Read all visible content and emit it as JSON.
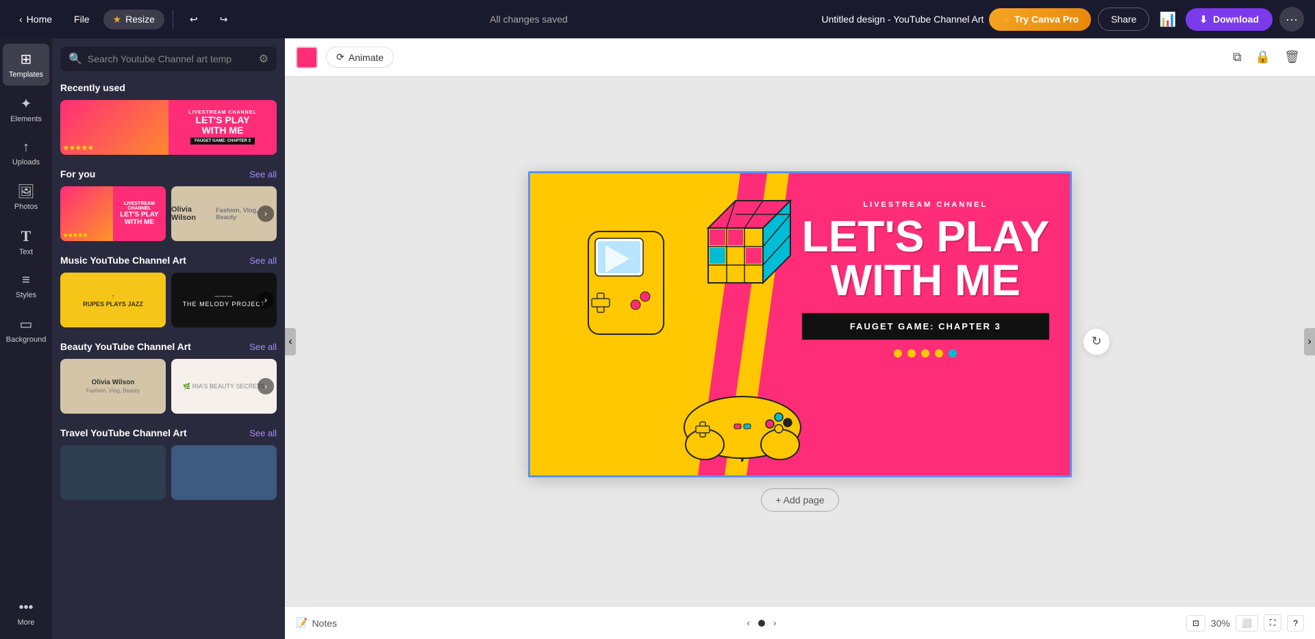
{
  "nav": {
    "home_label": "Home",
    "file_label": "File",
    "resize_label": "Resize",
    "status_label": "All changes saved",
    "title": "Untitled design - YouTube Channel Art",
    "try_pro_label": "Try Canva Pro",
    "share_label": "Share",
    "download_label": "Download"
  },
  "sidebar": {
    "items": [
      {
        "id": "templates",
        "label": "Templates",
        "icon": "⊞"
      },
      {
        "id": "elements",
        "label": "Elements",
        "icon": "✦"
      },
      {
        "id": "uploads",
        "label": "Uploads",
        "icon": "↑"
      },
      {
        "id": "photos",
        "label": "Photos",
        "icon": "🖼"
      },
      {
        "id": "text",
        "label": "Text",
        "icon": "T"
      },
      {
        "id": "styles",
        "label": "Styles",
        "icon": "≡"
      },
      {
        "id": "background",
        "label": "Background",
        "icon": "▭"
      },
      {
        "id": "more",
        "label": "More",
        "icon": "•••"
      }
    ]
  },
  "templates_panel": {
    "search_placeholder": "Search Youtube Channel art temp",
    "sections": [
      {
        "id": "recently_used",
        "title": "Recently used",
        "see_all": false,
        "templates": [
          {
            "id": "gaming1",
            "type": "gaming",
            "label": "LET'S PLAY WITH ME"
          }
        ]
      },
      {
        "id": "for_you",
        "title": "For you",
        "see_all": true,
        "see_all_label": "See all",
        "templates": [
          {
            "id": "gaming2",
            "type": "gaming",
            "label": "LET'S PLAY WITH ME"
          },
          {
            "id": "olivia1",
            "type": "olivia",
            "label": "Olivia Wilson"
          }
        ]
      },
      {
        "id": "music",
        "title": "Music YouTube Channel Art",
        "see_all": true,
        "see_all_label": "See all",
        "templates": [
          {
            "id": "jazz1",
            "type": "jazz",
            "label": "RUPES PLAYS JAZZ"
          },
          {
            "id": "melody1",
            "type": "melody",
            "label": "THE MELODY PROJECT"
          }
        ]
      },
      {
        "id": "beauty",
        "title": "Beauty YouTube Channel Art",
        "see_all": true,
        "see_all_label": "See all",
        "templates": [
          {
            "id": "beauty1",
            "type": "beauty1",
            "label": "Olivia Wilson"
          },
          {
            "id": "beauty2",
            "type": "beauty2",
            "label": "RIA'S BEAUTY SECRETS"
          }
        ]
      },
      {
        "id": "travel",
        "title": "Travel YouTube Channel Art",
        "see_all": true,
        "see_all_label": "See all",
        "templates": []
      }
    ]
  },
  "canvas_toolbar": {
    "color_hex": "#ff2d78",
    "animate_label": "Animate"
  },
  "canvas": {
    "subtitle": "LIVESTREAM CHANNEL",
    "title_line1": "LET'S PLAY",
    "title_line2": "WITH ME",
    "chapter_label": "FAUGET GAME: CHAPTER 3",
    "dots_count": 5
  },
  "bottom_bar": {
    "notes_label": "Notes",
    "zoom_level": "30%",
    "add_page_label": "+ Add page"
  }
}
